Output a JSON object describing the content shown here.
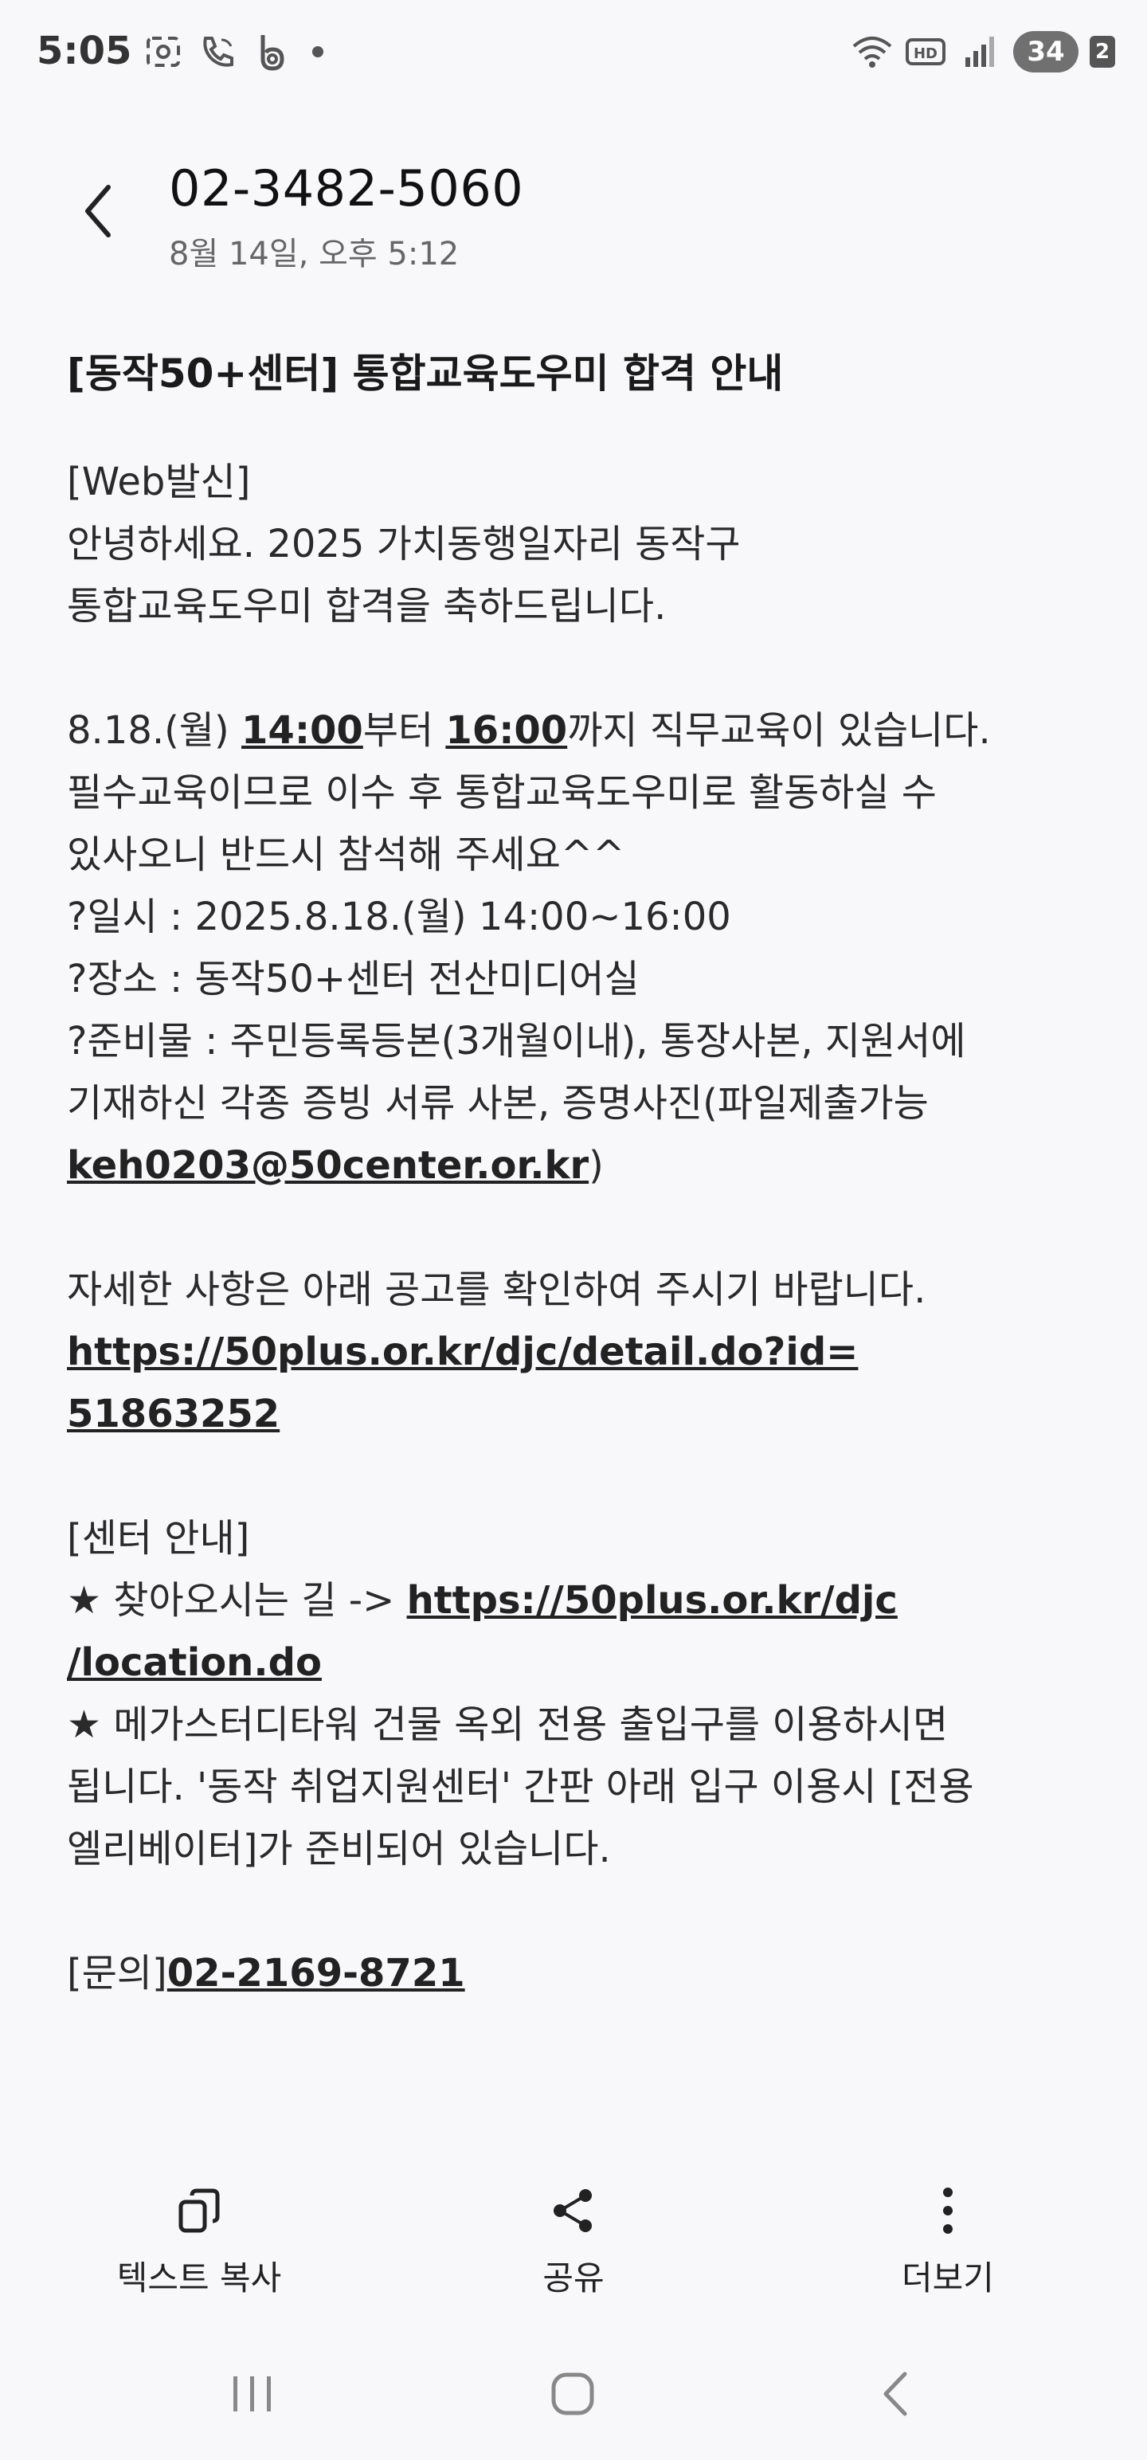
{
  "status_bar": {
    "time": "5:05",
    "battery": "34",
    "sim": "2",
    "icons": [
      "screen-capture-icon",
      "wifi-calling-icon",
      "b-app-icon",
      "notification-dot",
      "wifi-icon",
      "hd-voice-icon",
      "signal-icon"
    ]
  },
  "header": {
    "sender": "02-3482-5060",
    "date": "8월 14일, 오후 5:12",
    "back_icon": "back-arrow-icon"
  },
  "message": {
    "title": "[동작50+센터] 통합교육도우미 합격 안내",
    "intro_1": "[Web발신]",
    "intro_2": "안녕하세요. 2025 가치동행일자리 동작구",
    "intro_3": "통합교육도우미 합격을 축하드립니다.",
    "p2_date": "8.18.(월) ",
    "p2_start": "14:00",
    "p2_mid": "부터 ",
    "p2_end": "16:00",
    "p2_tail": "까지 직무교육이 있습니다.",
    "p2_line2": "필수교육이므로 이수 후 통합교육도우미로 활동하실 수",
    "p2_line3": "있사오니 반드시 참석해 주세요^^",
    "when": "?일시 : 2025.8.18.(월) 14:00~16:00",
    "where": "?장소 : 동작50+센터 전산미디어실",
    "prep_1": "?준비물 : 주민등록등본(3개월이내), 통장사본, 지원서에",
    "prep_2": "기재하신 각종 증빙 서류 사본, 증명사진(파일제출가능",
    "email": "keh0203@50center.or.kr",
    "email_close": ")",
    "notice_text": "자세한 사항은 아래 공고를 확인하여 주시기 바랍니다.",
    "notice_link_1": "https://50plus.or.kr/djc/detail.do?id=",
    "notice_link_2": "51863252",
    "center_head": "[센터 안내]",
    "directions_prefix": "★ 찾아오시는 길 -> ",
    "directions_link_1": "https://50plus.or.kr/djc",
    "directions_link_2": "/location.do",
    "entrance_1": "★ 메가스터디타워 건물 옥외 전용 출입구를 이용하시면",
    "entrance_2": "됩니다. '동작 취업지원센터' 간판 아래 입구 이용시 [전용",
    "entrance_3": "엘리베이터]가 준비되어 있습니다.",
    "contact_prefix": "[문의]",
    "contact_number": "02-2169-8721"
  },
  "actions": {
    "copy": {
      "label": "텍스트 복사",
      "icon": "copy-icon"
    },
    "share": {
      "label": "공유",
      "icon": "share-icon"
    },
    "more": {
      "label": "더보기",
      "icon": "more-vertical-icon"
    }
  },
  "navbar": {
    "recents_icon": "recents-icon",
    "home_icon": "home-icon",
    "back_icon": "nav-back-icon"
  }
}
